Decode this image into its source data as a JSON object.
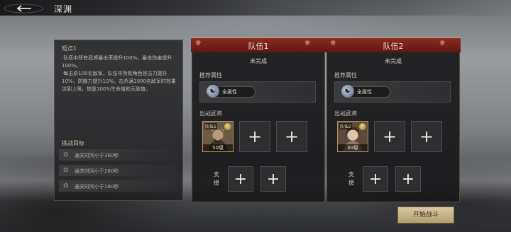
{
  "header": {
    "title": "深渊"
  },
  "info": {
    "title": "矩点1",
    "paragraphs": [
      "·队伍中所有武将暴击率提升100%，暴击伤害提升100%。",
      "·每击杀100名敌军，队伍中所有角色攻击力提升10%，防御力提升10%。击杀满1000名敌军时效果达到上限，恢复100%生命值和无敌值。"
    ],
    "goal_title": "挑战目标",
    "goals": [
      "通关时间小于360秒",
      "通关时间小于260秒",
      "通关时间小于160秒"
    ]
  },
  "teams": [
    {
      "name": "队伍1",
      "status": "未完成",
      "attr_label": "推荐属性",
      "attr_value": "全属性",
      "deploy_label": "出战武将",
      "hero": {
        "tag": "队伍1",
        "level": "50级"
      },
      "support_label": "支援"
    },
    {
      "name": "队伍2",
      "status": "未完成",
      "attr_label": "推荐属性",
      "attr_value": "全属性",
      "deploy_label": "出战武将",
      "hero": {
        "tag": "队伍2",
        "level": "30级"
      },
      "support_label": "支援"
    }
  ],
  "actions": {
    "start": "开始战斗"
  },
  "icons": {
    "plus": "+",
    "gear": "✿",
    "attr": "☯"
  }
}
